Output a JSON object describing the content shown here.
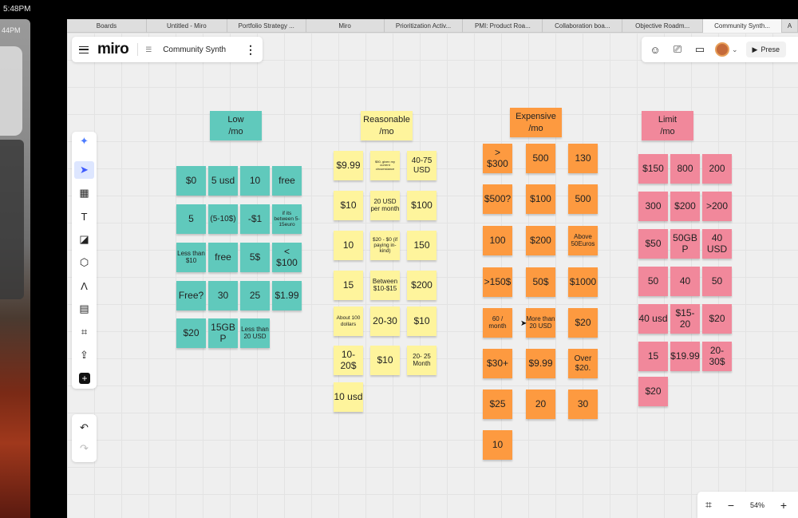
{
  "os": {
    "clock_top": "5:48PM",
    "clock_side": "44PM"
  },
  "tabs": [
    {
      "label": "Boards",
      "active": false
    },
    {
      "label": "Untitled - Miro",
      "active": false
    },
    {
      "label": "Portfolio Strategy ...",
      "active": false
    },
    {
      "label": "Miro",
      "active": false
    },
    {
      "label": "Prioritization Activ...",
      "active": false
    },
    {
      "label": "PMI: Product Roa...",
      "active": false
    },
    {
      "label": "Collaboration boa...",
      "active": false
    },
    {
      "label": "Objective Roadm...",
      "active": false
    },
    {
      "label": "Community Synth...",
      "active": true
    },
    {
      "label": "A",
      "active": false
    }
  ],
  "topbar": {
    "logo": "miro",
    "board_icon": "board-icon",
    "board_name": "Community Synth",
    "more": "⋮"
  },
  "topright": {
    "icons": [
      "reactions-icon",
      "activity-icon",
      "video-icon"
    ],
    "avatar_caret": "⌄",
    "present_label": "Prese",
    "present_icon": "▶"
  },
  "toolbar": {
    "tools": [
      {
        "name": "ai-sparkle-icon",
        "glyph": "✦"
      },
      {
        "name": "select-icon",
        "glyph": "➤",
        "selected": true
      },
      {
        "name": "templates-icon",
        "glyph": "▦"
      },
      {
        "name": "text-icon",
        "glyph": "T"
      },
      {
        "name": "sticky-note-icon",
        "glyph": "◪"
      },
      {
        "name": "shapes-icon",
        "glyph": "⬡"
      },
      {
        "name": "pen-icon",
        "glyph": "Λ"
      },
      {
        "name": "comment-icon",
        "glyph": "▤"
      },
      {
        "name": "frame-icon",
        "glyph": "⌗"
      },
      {
        "name": "upload-icon",
        "glyph": "⇪"
      },
      {
        "name": "add-icon",
        "glyph": "+"
      }
    ],
    "undo": "↶",
    "redo": "↷"
  },
  "zoom": {
    "fit": "⌗",
    "minus": "−",
    "level": "54%",
    "plus": "+"
  },
  "columns": {
    "low": {
      "header": "Low\n/mo",
      "color": "#60c9bc",
      "notes": [
        "$0",
        "5 usd",
        "10",
        "free",
        "5",
        "(5-10$)",
        "-$1",
        "if its between 5-15euro",
        "Less than $10",
        "free",
        "5$",
        "< $100",
        "Free?",
        "30",
        "25",
        "$1.99",
        "$20",
        "15GBP",
        "Less than 20 USD"
      ]
    },
    "reasonable": {
      "header": "Reasonable\n/mo",
      "color": "#fef49c",
      "notes": [
        "$9.99",
        "$50, given my current circumstance",
        "40-75 USD",
        "$10",
        "20 USD per month",
        "$100",
        "10",
        "$20 - $0 (if paying in-kind)",
        "150",
        "15",
        "Between $10-$15",
        "$200",
        "About 100 dollars",
        "20-30",
        "$10",
        "10-20$",
        "$10",
        "20- 25 Month",
        "10 usd"
      ]
    },
    "expensive": {
      "header": "Expensive\n/mo",
      "color": "#fd9a40",
      "notes": [
        "> $300",
        "500",
        "130",
        "$500?",
        "$100",
        "500",
        "100",
        "$200",
        "Above 50Euros",
        ">150$",
        "50$",
        "$1000",
        "60 / month",
        "More than 20 USD",
        "$20",
        "$30+",
        "$9.99",
        "Over $20.",
        "$25",
        "20",
        "30",
        "10"
      ]
    },
    "limit": {
      "header": "Limit\n/mo",
      "color": "#f1889b",
      "notes": [
        "$150",
        "800",
        "200",
        "300",
        "$200",
        ">200",
        "$50",
        "50GBP",
        "40 USD",
        "50",
        "40",
        "50",
        "40 usd",
        "$15-20",
        "$20",
        "15",
        "$19.99",
        "20-30$",
        "$20"
      ]
    }
  }
}
